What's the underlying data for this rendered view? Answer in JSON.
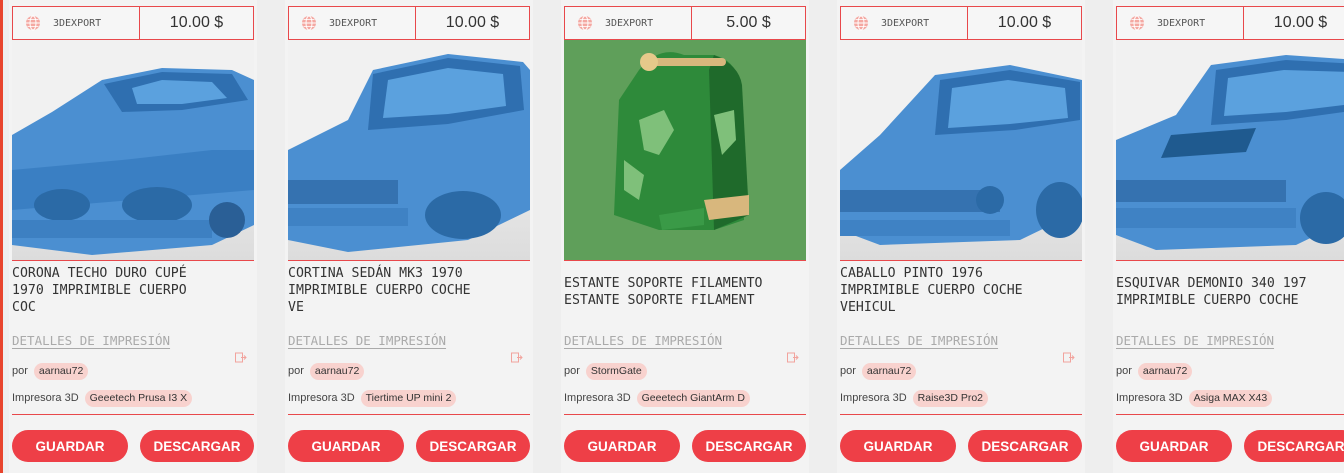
{
  "accent_color": "#ee3f47",
  "cards": [
    {
      "source": "3DEXPORT",
      "price": "10.00 $",
      "title": "CORONA TECHO DURO CUPÉ\n1970 IMPRIMIBLE CUERPO\nCOC",
      "details_label": "DETALLES DE IMPRESIÓN",
      "by_label": "por",
      "author": "aarnau72",
      "printer_label": "Impresora 3D",
      "printer": "Geeetech Prusa I3 X",
      "save_label": "GUARDAR",
      "download_label": "DESCARGAR",
      "thumbnail": "blue-car-model"
    },
    {
      "source": "3DEXPORT",
      "price": "10.00 $",
      "title": "CORTINA SEDÁN MK3 1970\nIMPRIMIBLE CUERPO COCHE\nVE",
      "details_label": "DETALLES DE IMPRESIÓN",
      "by_label": "por",
      "author": "aarnau72",
      "printer_label": "Impresora 3D",
      "printer": "Tiertime UP mini 2",
      "save_label": "GUARDAR",
      "download_label": "DESCARGAR",
      "thumbnail": "blue-car-model"
    },
    {
      "source": "3DEXPORT",
      "price": "5.00 $",
      "title": "ESTANTE SOPORTE FILAMENTO\nESTANTE SOPORTE FILAMENT",
      "details_label": "DETALLES DE IMPRESIÓN",
      "by_label": "por",
      "author": "StormGate",
      "printer_label": "Impresora 3D",
      "printer": "Geeetech GiantArm D",
      "save_label": "GUARDAR",
      "download_label": "DESCARGAR",
      "thumbnail": "green-filament-stand"
    },
    {
      "source": "3DEXPORT",
      "price": "10.00 $",
      "title": "CABALLO PINTO 1976\nIMPRIMIBLE CUERPO COCHE\nVEHICUL",
      "details_label": "DETALLES DE IMPRESIÓN",
      "by_label": "por",
      "author": "aarnau72",
      "printer_label": "Impresora 3D",
      "printer": "Raise3D Pro2",
      "save_label": "GUARDAR",
      "download_label": "DESCARGAR",
      "thumbnail": "blue-car-model"
    },
    {
      "source": "3DEXPORT",
      "price": "10.00 $",
      "title": "ESQUIVAR DEMONIO 340 197\nIMPRIMIBLE CUERPO COCHE",
      "details_label": "DETALLES DE IMPRESIÓN",
      "by_label": "por",
      "author": "aarnau72",
      "printer_label": "Impresora 3D",
      "printer": "Asiga MAX X43",
      "save_label": "GUARDAR",
      "download_label": "DESCARGAR",
      "thumbnail": "blue-car-model"
    }
  ]
}
